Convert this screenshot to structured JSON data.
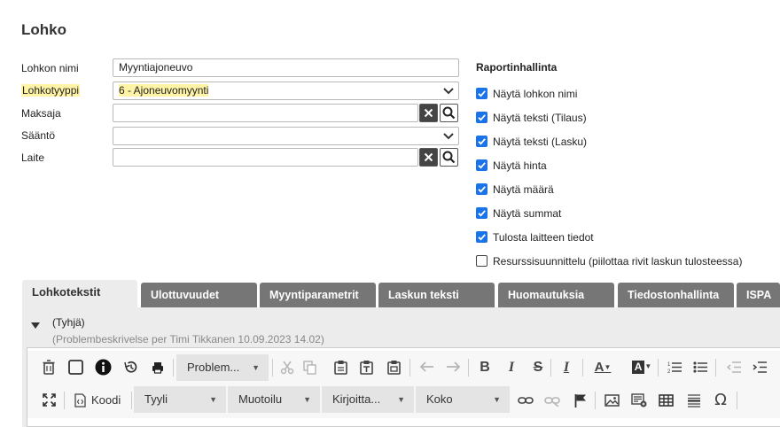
{
  "page": {
    "title": "Lohko"
  },
  "form": {
    "fields": [
      {
        "label": "Lohkon nimi",
        "value": "Myyntiajoneuvo"
      },
      {
        "label": "Lohkotyyppi",
        "value": "6 - Ajoneuvomyynti"
      },
      {
        "label": "Maksaja",
        "value": ""
      },
      {
        "label": "Sääntö",
        "value": ""
      },
      {
        "label": "Laite",
        "value": ""
      }
    ]
  },
  "report": {
    "title": "Raportinhallinta",
    "options": [
      {
        "label": "Näytä lohkon nimi",
        "checked": true
      },
      {
        "label": "Näytä teksti (Tilaus)",
        "checked": true
      },
      {
        "label": "Näytä teksti (Lasku)",
        "checked": true
      },
      {
        "label": "Näytä hinta",
        "checked": true
      },
      {
        "label": "Näytä määrä",
        "checked": true
      },
      {
        "label": "Näytä summat",
        "checked": true
      },
      {
        "label": "Tulosta laitteen tiedot",
        "checked": true
      },
      {
        "label": "Resurssisuunnittelu (piilottaa rivit laskun tulosteessa)",
        "checked": false
      }
    ]
  },
  "tabs": [
    "Lohkotekstit",
    "Ulottuvuudet",
    "Myyntiparametrit",
    "Laskun teksti",
    "Huomautuksia",
    "Tiedostonhallinta",
    "ISPA"
  ],
  "section": {
    "header": "(Tyhjä)",
    "subheader": "(Problembeskrivelse per Timi Tikkanen 10.09.2023 14.02)"
  },
  "toolbar": {
    "template_combo": "Problem...",
    "source_label": "Koodi",
    "style_combo": "Tyyli",
    "format_combo": "Muotoilu",
    "font_combo": "Kirjoitta...",
    "size_combo": "Koko"
  },
  "colors": {
    "highlight": "#fff3a6",
    "checkbox": "#1a73e8",
    "tab": "#767676"
  }
}
